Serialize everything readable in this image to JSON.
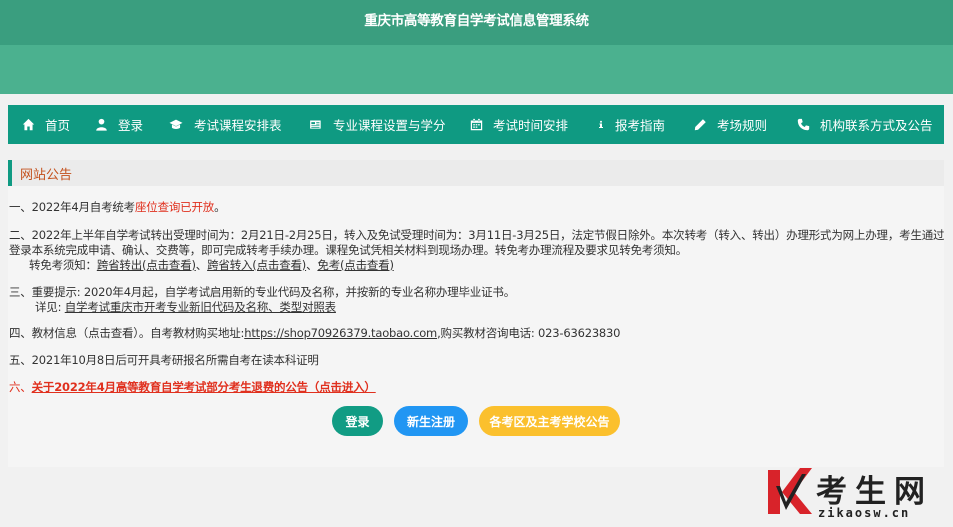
{
  "header": {
    "title": "重庆市高等教育自学考试信息管理系统"
  },
  "nav": [
    {
      "label": "首页",
      "icon": "home-icon"
    },
    {
      "label": "登录",
      "icon": "user-icon"
    },
    {
      "label": "考试课程安排表",
      "icon": "graduation-cap-icon"
    },
    {
      "label": "专业课程设置与学分",
      "icon": "newspaper-icon"
    },
    {
      "label": "考试时间安排",
      "icon": "calendar-icon"
    },
    {
      "label": "报考指南",
      "icon": "info-icon"
    },
    {
      "label": "考场规则",
      "icon": "pencil-icon"
    },
    {
      "label": "机构联系方式及公告",
      "icon": "phone-icon"
    }
  ],
  "panel": {
    "title": "网站公告"
  },
  "notices": {
    "n1_prefix": "一、2022年4月自考统考",
    "n1_link": "座位查询已开放",
    "n1_suffix": "。",
    "n2_line1": "二、2022年上半年自学考试转出受理时间为：2月21日-2月25日，转入及免试受理时间为：3月11日-3月25日，法定节假日除外。本次转考（转入、转出）办理形式为网上办理，考生通过",
    "n2_line2": "登录本系统完成申请、确认、交费等，即可完成转考手续办理。课程免试凭相关材料到现场办理。转免考办理流程及要求见转免考须知。",
    "n2_sub_label": "转免考须知：",
    "n2_link1": "跨省转出(点击查看)",
    "n2_sep1": "、",
    "n2_link2": "跨省转入(点击查看)",
    "n2_sep2": "、",
    "n2_link3": "免考(点击查看)",
    "n3_line1": "三、重要提示: 2020年4月起，自学考试启用新的专业代码及名称，并按新的专业名称办理毕业证书。",
    "n3_sub_label": "详见: ",
    "n3_link": "自学考试重庆市开考专业新旧代码及名称、类型对照表",
    "n4_prefix": "四、教材信息（点击查看）。自考教材购买地址:",
    "n4_link": "https://shop70926379.taobao.com",
    "n4_suffix": ",购买教材咨询电话:  023-63623830",
    "n5": "五、2021年10月8日后可开具考研报名所需自考在读本科证明",
    "n6_prefix": "六、",
    "n6_link": "关于2022年4月高等教育自学考试部分考生退费的公告（点击进入）"
  },
  "buttons": {
    "login": "登录",
    "register": "新生注册",
    "area_notice": "各考区及主考学校公告"
  },
  "watermark": {
    "cn": "考生网",
    "en": "zikaosw.cn"
  },
  "colors": {
    "nav_bg": "#0f9a82",
    "header_bg": "#3a9e7f",
    "accent_red": "#e0301e",
    "blue": "#2196f3",
    "yellow": "#fbc02d"
  }
}
